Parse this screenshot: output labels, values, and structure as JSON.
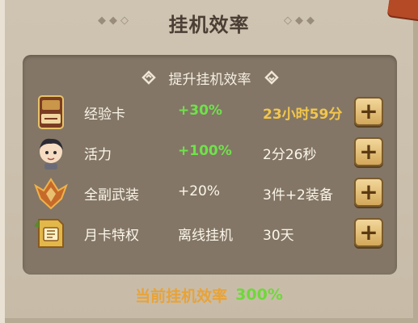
{
  "header": {
    "title": "挂机效率",
    "deco_left": "◆◆◇",
    "deco_right": "◇◆◆"
  },
  "section": {
    "subtitle": "提升挂机效率"
  },
  "rows": [
    {
      "name": "经验卡",
      "bonus": "+30%",
      "info": "23小时59分",
      "icon": "exp-card-icon",
      "bonus_highlight": true,
      "info_highlight": true
    },
    {
      "name": "活力",
      "bonus": "+100%",
      "info": "2分26秒",
      "icon": "vitality-avatar-icon",
      "bonus_highlight": true,
      "info_highlight": false
    },
    {
      "name": "全副武装",
      "bonus": "+20%",
      "info": "3件+2装备",
      "icon": "armor-helmet-icon",
      "bonus_highlight": false,
      "info_highlight": false
    },
    {
      "name": "月卡特权",
      "bonus": "离线挂机",
      "info": "30天",
      "icon": "monthly-card-icon",
      "bonus_highlight": false,
      "info_highlight": false
    }
  ],
  "footer": {
    "label": "当前挂机效率",
    "value": "300%"
  },
  "colors": {
    "green": "#6fe24a",
    "gold": "#f3c64c",
    "orange": "#e8a338"
  }
}
